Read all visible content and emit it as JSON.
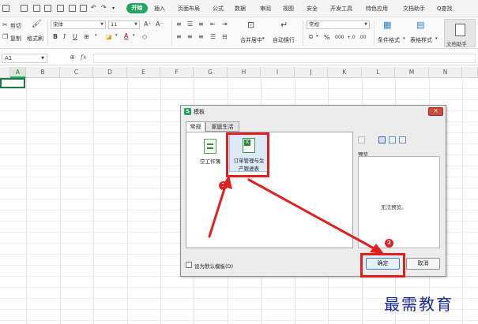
{
  "menubar": {
    "start_label": "开始",
    "items": [
      "插入",
      "页面布局",
      "公式",
      "数据",
      "审阅",
      "视图",
      "安全",
      "开发工具",
      "特色应用",
      "文档助手"
    ],
    "search_label": "Q查找"
  },
  "ribbon": {
    "cut_label": "剪切",
    "copy_label": "复制",
    "format_painter_label": "格式刷",
    "font_name": "宋体",
    "font_size": "11",
    "number_format": "常规",
    "merge_center_label": "合并居中",
    "wrap_text_label": "自动换行",
    "percent_label": "%",
    "thousands_label": "000",
    "decimal_more_label": "+.0",
    "decimal_less_label": ".00",
    "conditional_format_label": "条件格式",
    "table_style_label": "表格样式",
    "doc_helper_label": "文档助手"
  },
  "formulabar": {
    "cell_ref": "A1",
    "fx_label": "fx"
  },
  "sheet": {
    "columns": [
      "A",
      "B",
      "C",
      "D",
      "E",
      "F",
      "G",
      "H",
      "I",
      "J",
      "K",
      "L",
      "M",
      "N"
    ],
    "selected_column": "A"
  },
  "dialog": {
    "title": "模板",
    "tabs": [
      "常规",
      "家庭生活"
    ],
    "templates": [
      {
        "label": "空工作簿"
      },
      {
        "label_line1": "订单管理与生",
        "label_line2": "产跟进表"
      }
    ],
    "preview_label": "预览",
    "no_preview": "无法预览。",
    "set_default_label": "设为默认模板(D)",
    "ok_label": "确定",
    "cancel_label": "取消",
    "badge_1": "1",
    "badge_2": "2"
  },
  "watermark": "最需教育",
  "colors": {
    "accent": "#22a562",
    "annotation": "#e02020",
    "watermark": "#1a2a8a"
  }
}
